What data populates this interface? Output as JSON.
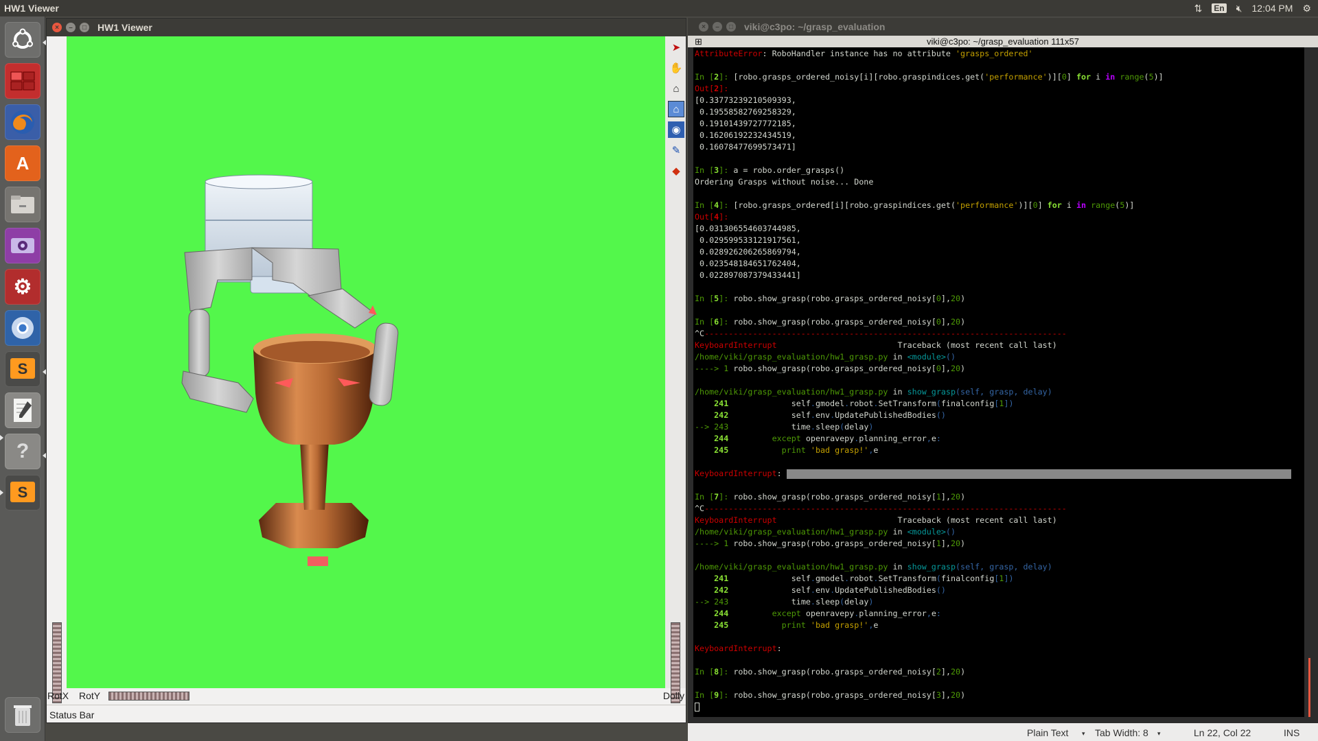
{
  "topbar": {
    "app_title": "HW1 Viewer",
    "lang": "En",
    "time": "12:04 PM"
  },
  "launcher": {
    "items": [
      "ubuntu-dash",
      "workspace-switcher",
      "firefox",
      "software-center",
      "files",
      "shotwell",
      "system-settings",
      "chromium",
      "sublime-text",
      "text-editor",
      "help",
      "sublime-text-2",
      "trash"
    ]
  },
  "viewer": {
    "title": "HW1 Viewer",
    "rotx_label": "RotX",
    "roty_label": "RotY",
    "dolly_label": "Dolly",
    "status": "Status Bar",
    "viewport_color": "#53f74b",
    "tools": [
      "select-arrow-icon",
      "hand-icon",
      "home-icon",
      "set-home-icon",
      "view-all-icon",
      "seek-icon",
      "perspective-icon"
    ]
  },
  "terminal": {
    "title": "viki@c3po: ~/grasp_evaluation",
    "tab_title": "viki@c3po: ~/grasp_evaluation 111x57"
  },
  "gedit": {
    "mode": "Plain Text",
    "tab_width": "Tab Width: 8",
    "position": "Ln 22, Col 22",
    "ins": "INS"
  }
}
